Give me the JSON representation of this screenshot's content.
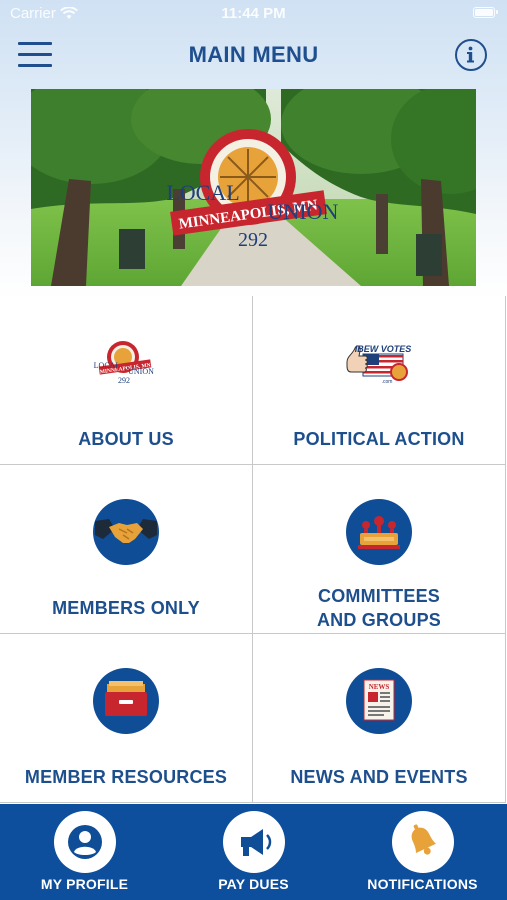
{
  "status_bar": {
    "carrier": "Carrier",
    "time": "11:44 PM"
  },
  "nav": {
    "title": "MAIN MENU",
    "menu_icon": "hamburger-menu-icon",
    "info_icon": "info-icon"
  },
  "banner": {
    "seal_ring_text": "INTERNATIONAL BROTHERHOOD OF ELECTRICAL WORKERS",
    "ribbon_text": "MINNEAPOLIS, MN",
    "local_text": "LOCAL",
    "union_text": "UNION",
    "number_text": "292"
  },
  "menu": {
    "tiles": [
      {
        "label": "ABOUT US",
        "icon": "local-292-logo-icon",
        "logo": {
          "local": "LOCAL",
          "union": "UNION",
          "number": "292",
          "ribbon": "MINNEAPOLIS, MN"
        }
      },
      {
        "label": "POLITICAL ACTION",
        "icon": "ibew-votes-icon",
        "logo": {
          "top": "IBEW VOTES",
          "sub": ".com"
        }
      },
      {
        "label": "MEMBERS ONLY",
        "icon": "handshake-icon"
      },
      {
        "label_line1": "COMMITTEES",
        "label_line2": "AND GROUPS",
        "icon": "podium-icon"
      },
      {
        "label": "MEMBER RESOURCES",
        "icon": "file-drawer-icon"
      },
      {
        "label": "NEWS AND EVENTS",
        "icon": "newspaper-icon",
        "newspaper_text": "NEWS"
      }
    ]
  },
  "tab_bar": {
    "tabs": [
      {
        "label": "MY PROFILE",
        "icon": "user-profile-icon"
      },
      {
        "label": "PAY DUES",
        "icon": "megaphone-icon"
      },
      {
        "label": "NOTIFICATIONS",
        "icon": "bell-icon"
      }
    ]
  },
  "colors": {
    "primary": "#1e4f8d",
    "tab_bar": "#0d4f9c",
    "icon_circle": "#0f4d96",
    "accent_red": "#c8262e",
    "accent_orange": "#e8a23a"
  }
}
